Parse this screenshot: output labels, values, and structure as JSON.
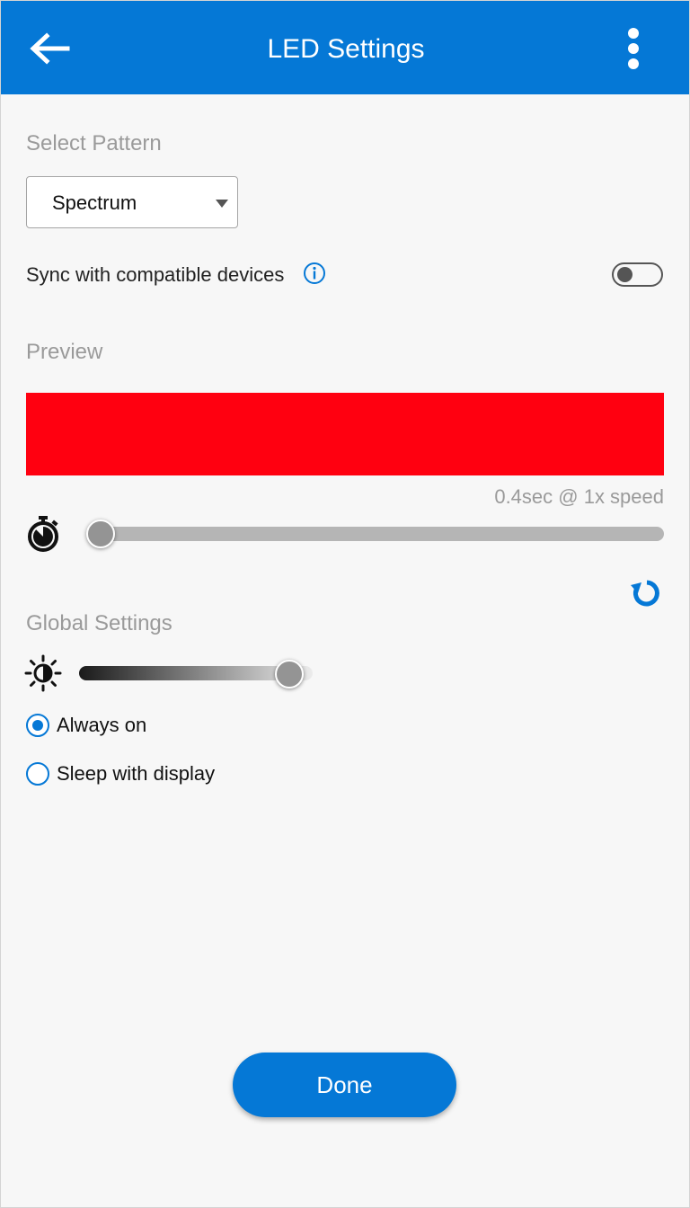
{
  "header": {
    "title": "LED Settings",
    "background": "#0578d6",
    "back_icon": "arrow-left-icon",
    "menu_icon": "more-vertical-icon"
  },
  "pattern": {
    "section_label": "Select Pattern",
    "selected": "Spectrum"
  },
  "sync": {
    "label": "Sync with compatible devices",
    "enabled": false
  },
  "preview": {
    "section_label": "Preview",
    "color": "#ff0010",
    "speed_text": "0.4sec @ 1x speed",
    "speed_level": 0
  },
  "global": {
    "section_label": "Global Settings",
    "brightness_level": 0.9,
    "options": [
      {
        "label": "Always on",
        "selected": true
      },
      {
        "label": "Sleep with display",
        "selected": false
      }
    ]
  },
  "footer": {
    "done_label": "Done"
  },
  "colors": {
    "accent": "#0578d6",
    "muted_text": "#9a9a9a"
  }
}
